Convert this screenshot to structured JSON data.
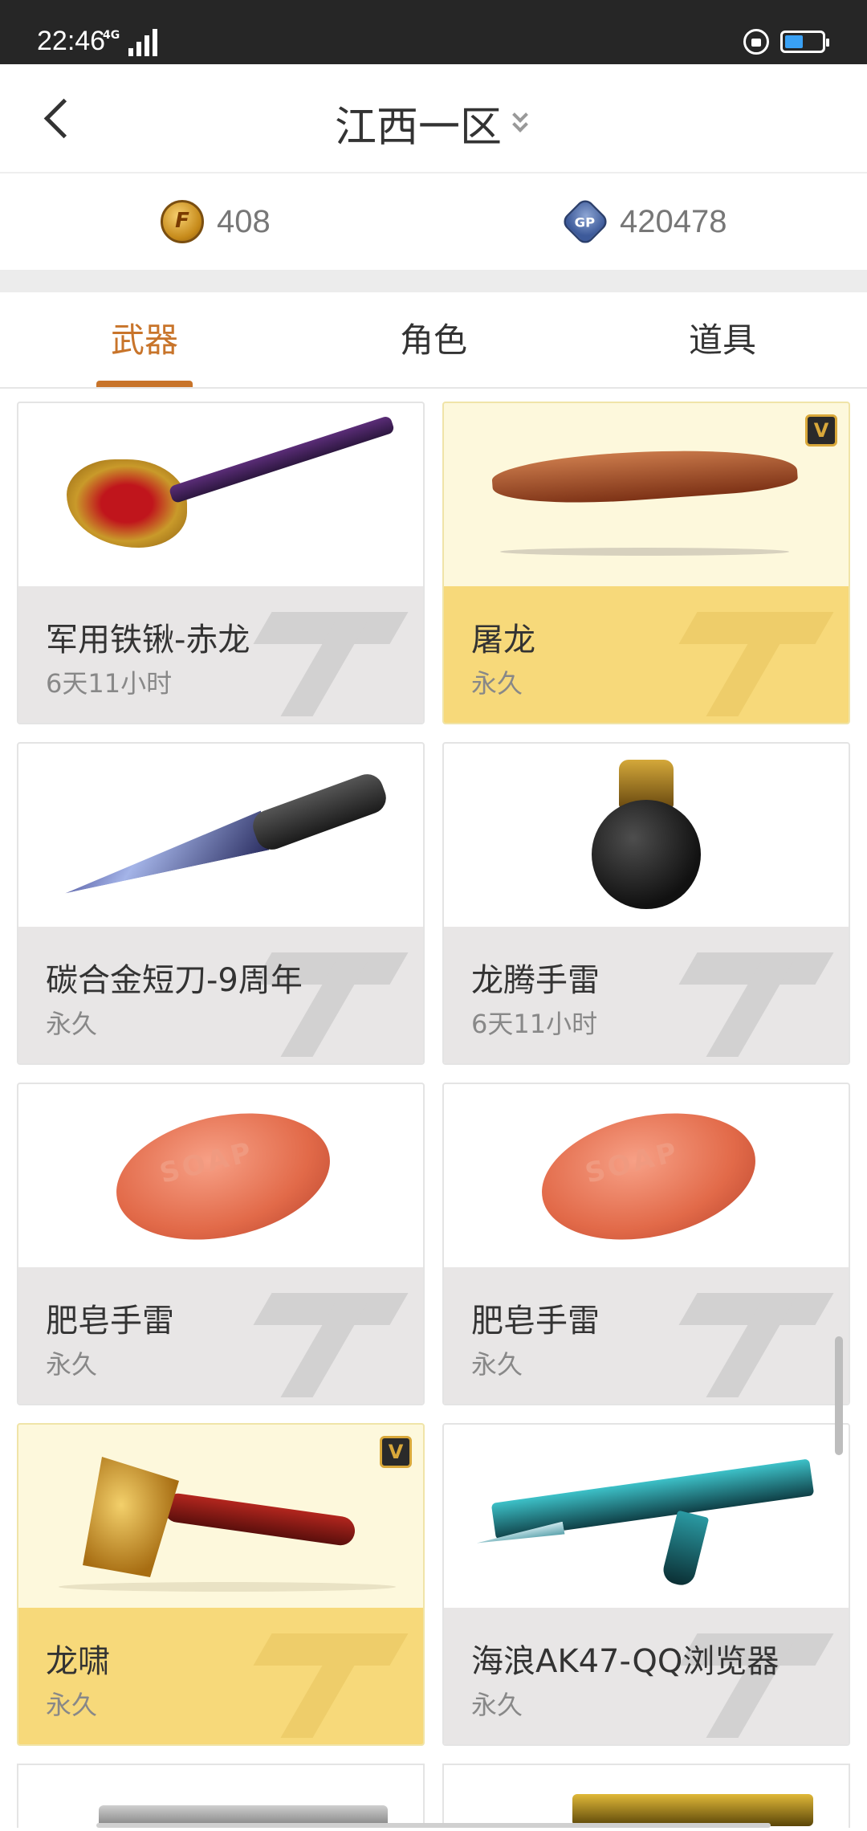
{
  "status_bar": {
    "time": "22:46",
    "network": "4G"
  },
  "header": {
    "title": "江西一区"
  },
  "currency": {
    "cf_points": "408",
    "gp": "420478"
  },
  "tabs": [
    {
      "label": "武器"
    },
    {
      "label": "角色"
    },
    {
      "label": "道具"
    }
  ],
  "items": [
    {
      "name": "军用铁锹-赤龙",
      "duration": "6天11小时",
      "vip": false
    },
    {
      "name": "屠龙",
      "duration": "永久",
      "vip": true
    },
    {
      "name": "碳合金短刀-9周年",
      "duration": "永久",
      "vip": false
    },
    {
      "name": "龙腾手雷",
      "duration": "6天11小时",
      "vip": false
    },
    {
      "name": "肥皂手雷",
      "duration": "永久",
      "vip": false
    },
    {
      "name": "肥皂手雷",
      "duration": "永久",
      "vip": false
    },
    {
      "name": "龙啸",
      "duration": "永久",
      "vip": true
    },
    {
      "name": "海浪AK47-QQ浏览器",
      "duration": "永久",
      "vip": false
    }
  ],
  "soap_label": "SOAP",
  "vip_badge_label": "V",
  "colors": {
    "accent": "#c8742a",
    "gold_card": "#f7d97a",
    "gold_card_top": "#fdf8dc"
  }
}
